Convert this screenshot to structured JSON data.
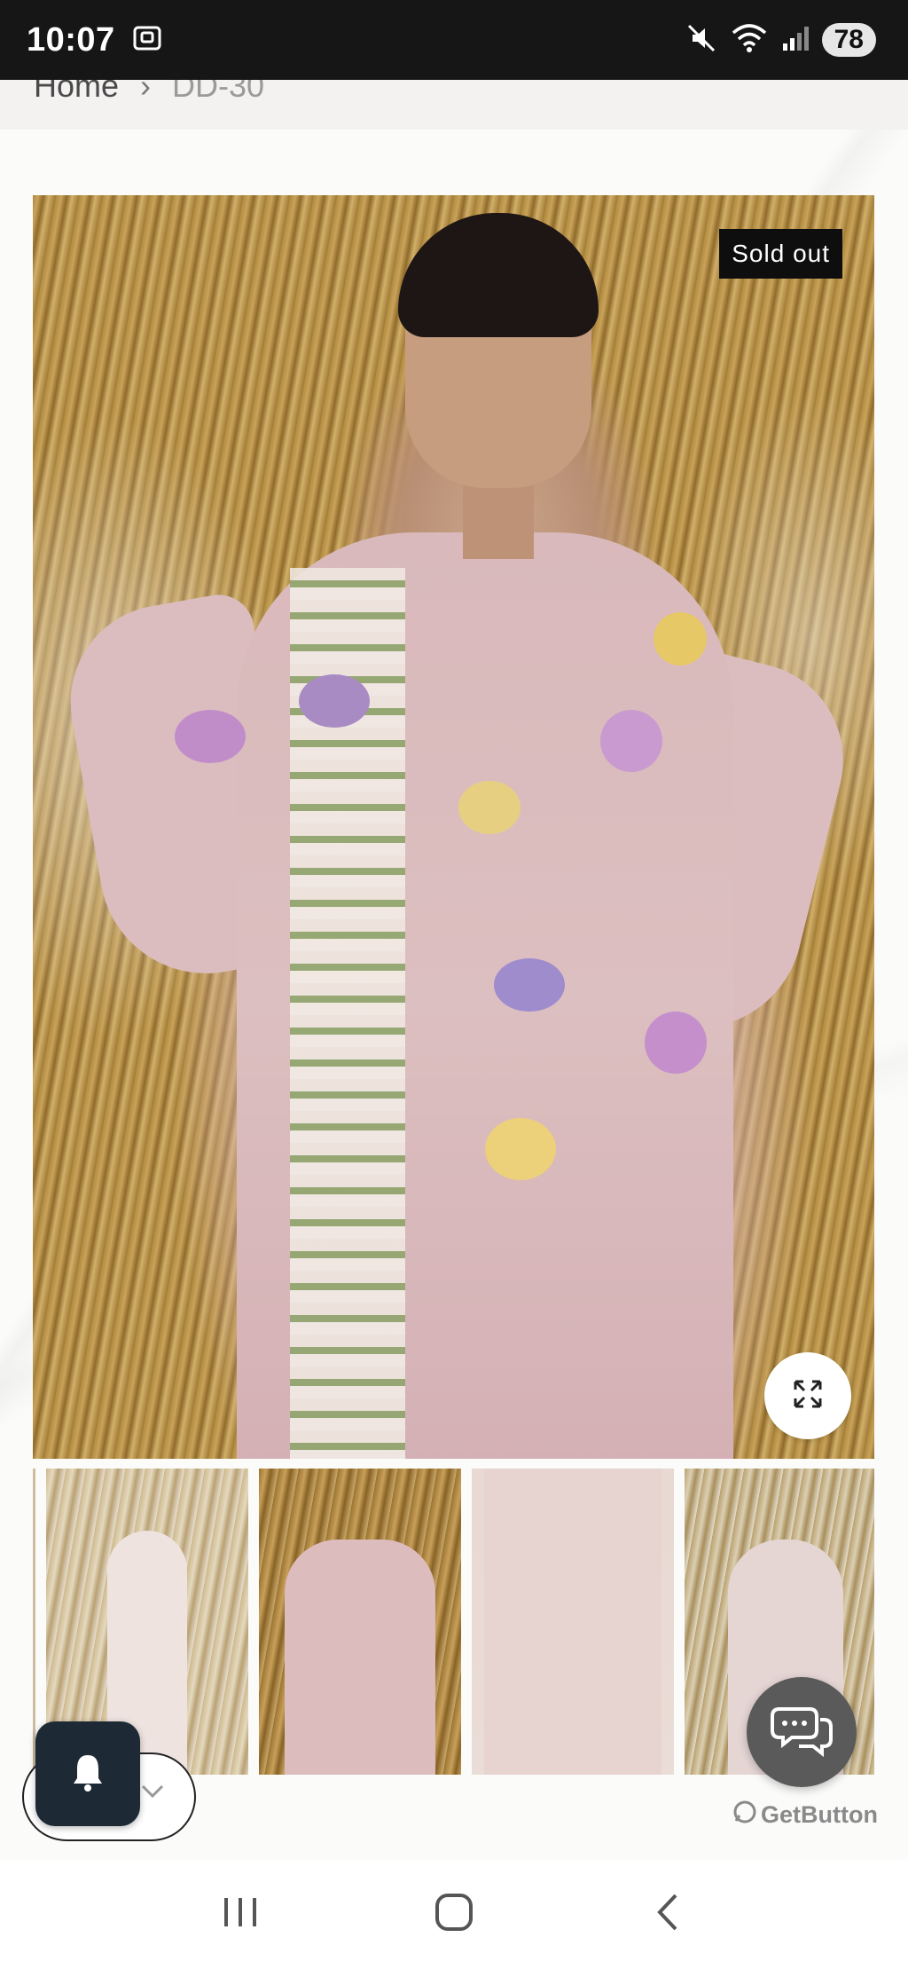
{
  "status_bar": {
    "time": "10:07",
    "battery": "78",
    "icons": [
      "screenshot-icon",
      "mute-icon",
      "wifi-icon",
      "signal-icon"
    ]
  },
  "breadcrumb": {
    "home": "Home",
    "separator": "›",
    "current": "DD-30"
  },
  "product": {
    "badge": "Sold out",
    "zoom_icon": "expand-icon"
  },
  "thumbnails": [
    "thumbnail-1",
    "thumbnail-2",
    "thumbnail-3",
    "thumbnail-4"
  ],
  "widgets": {
    "notification_icon": "bell-icon",
    "chat_icon": "chat-bubbles-icon",
    "brand": "GetButton"
  },
  "navigation": {
    "buttons": [
      "recent-apps",
      "home",
      "back"
    ]
  },
  "colors": {
    "status_bar": "#161616",
    "badge_bg": "#0e0e0e",
    "bell_bg": "#1d2a35",
    "chat_bg": "#5a5a5a"
  }
}
